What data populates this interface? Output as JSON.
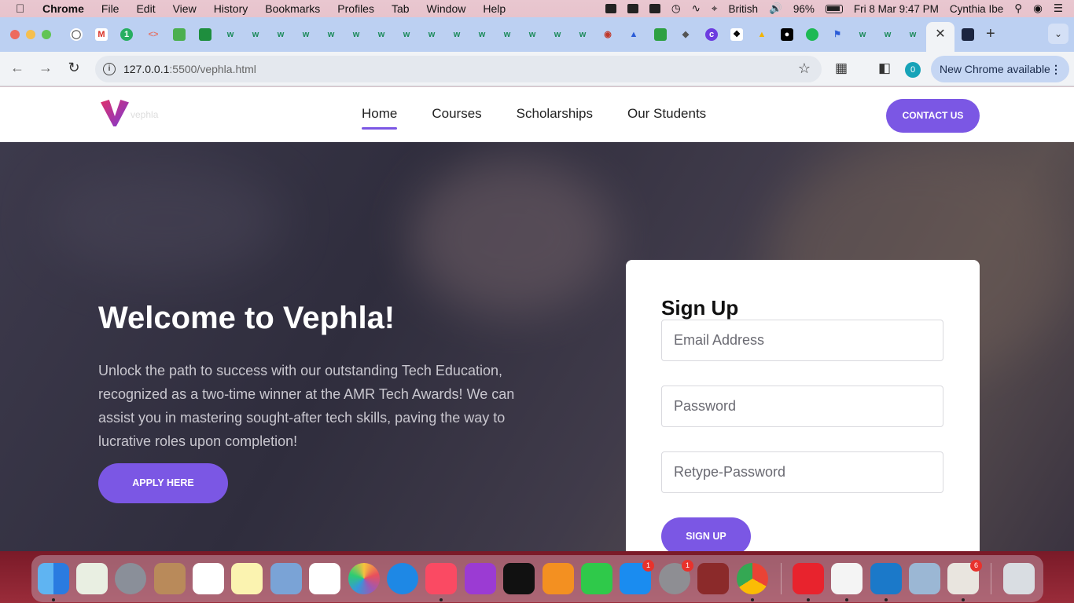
{
  "menubar": {
    "app_name": "Chrome",
    "menus": [
      "File",
      "Edit",
      "View",
      "History",
      "Bookmarks",
      "Profiles",
      "Tab",
      "Window",
      "Help"
    ],
    "input_source": "British",
    "battery": "96%",
    "datetime": "Fri 8 Mar  9:47 PM",
    "user": "Cynthia Ibe"
  },
  "browser": {
    "url_host": "127.0.0.1",
    "url_rest": ":5500/vephla.html",
    "profile_badge": "0",
    "update_label": "New Chrome available"
  },
  "site": {
    "logo_text": "vephla",
    "nav": [
      {
        "label": "Home",
        "active": true
      },
      {
        "label": "Courses",
        "active": false
      },
      {
        "label": "Scholarships",
        "active": false
      },
      {
        "label": "Our Students",
        "active": false
      }
    ],
    "contact_label": "CONTACT US"
  },
  "hero": {
    "title": "Welcome to Vephla!",
    "text": "Unlock the path to success with our outstanding Tech Education, recognized as a two-time winner at the AMR Tech Awards! We can assist you in mastering sought-after tech skills, paving the way to lucrative roles upon completion!",
    "apply_label": "APPLY HERE"
  },
  "signup": {
    "title": "Sign Up",
    "email_placeholder": "Email Address",
    "password_placeholder": "Password",
    "retype_placeholder": "Retype-Password",
    "button_label": "SIGN UP"
  },
  "dock": {
    "app_store_badge": "1",
    "settings_badge": "1",
    "downloads_badge": "6"
  },
  "colors": {
    "accent": "#7b57e4",
    "tabstrip": "#bcd0f2"
  }
}
